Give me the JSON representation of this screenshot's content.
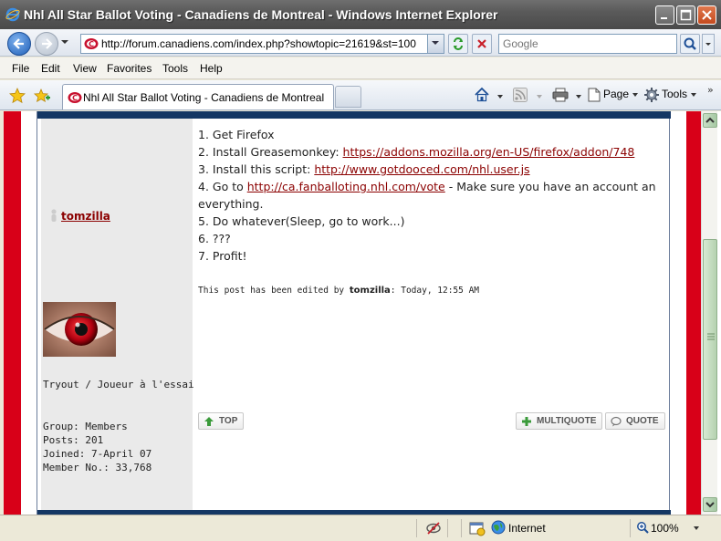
{
  "window": {
    "title": "Nhl All Star Ballot Voting - Canadiens de Montreal - Windows Internet Explorer"
  },
  "address_bar": {
    "url": "http://forum.canadiens.com/index.php?showtopic=21619&st=100",
    "search_placeholder": "Google"
  },
  "menu": {
    "items": [
      "File",
      "Edit",
      "View",
      "Favorites",
      "Tools",
      "Help"
    ]
  },
  "tab": {
    "label": "Nhl All Star Ballot Voting - Canadiens de Montreal"
  },
  "toolbar": {
    "page_label": "Page",
    "tools_label": "Tools"
  },
  "post": {
    "author": "tomzilla",
    "rank": "Tryout / Joueur à l'essai",
    "stats": {
      "group": "Group: Members",
      "posts": "Posts: 201",
      "joined": "Joined: 7-April 07",
      "member_no": "Member No.: 33,768"
    },
    "lines": [
      {
        "prefix": "1. Get Firefox",
        "link": "",
        "suffix": ""
      },
      {
        "prefix": "2. Install Greasemonkey: ",
        "link": "https://addons.mozilla.org/en-US/firefox/addon/748",
        "suffix": ""
      },
      {
        "prefix": "3. Install this script: ",
        "link": "http://www.gotdooced.com/nhl.user.js",
        "suffix": ""
      },
      {
        "prefix": "4. Go to ",
        "link": "http://ca.fanballoting.nhl.com/vote",
        "suffix": " - Make sure you have an account an"
      },
      {
        "prefix": "everything.",
        "link": "",
        "suffix": ""
      },
      {
        "prefix": "5. Do whatever(Sleep, go to work...)",
        "link": "",
        "suffix": ""
      },
      {
        "prefix": "6. ???",
        "link": "",
        "suffix": ""
      },
      {
        "prefix": "7. Profit!",
        "link": "",
        "suffix": ""
      }
    ],
    "edited_prefix": "This post has been edited by ",
    "edited_by": "tomzilla",
    "edited_suffix": ": Today, 12:55 AM",
    "buttons": {
      "top": "TOP",
      "multiquote": "MULTIQUOTE",
      "quote": "QUOTE"
    }
  },
  "status_bar": {
    "zone": "Internet",
    "zoom": "100%"
  },
  "colors": {
    "accent_red": "#d80018",
    "link": "#8b0000",
    "header_navy": "#143764"
  }
}
